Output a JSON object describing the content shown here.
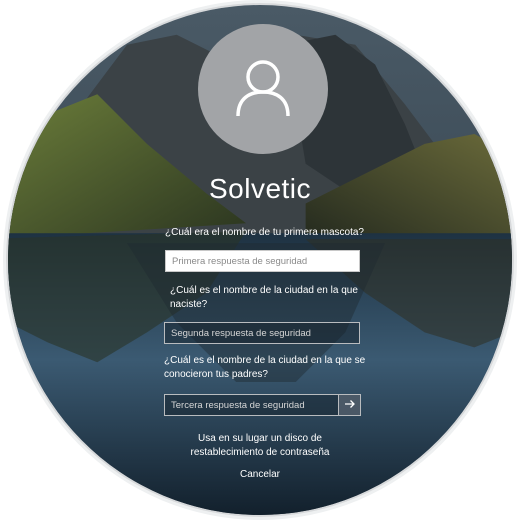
{
  "user": {
    "name": "Solvetic",
    "avatar_icon": "user-icon"
  },
  "questions": [
    {
      "question": "¿Cuál era el nombre de tu primera mascota?",
      "placeholder": "Primera respuesta de seguridad"
    },
    {
      "question": "¿Cuál es el nombre de la ciudad en la que naciste?",
      "placeholder": "Segunda respuesta de seguridad"
    },
    {
      "question": "¿Cuál es el nombre de la ciudad en la que se conocieron tus padres?",
      "placeholder": "Tercera respuesta de seguridad"
    }
  ],
  "submit_icon": "arrow-right-icon",
  "reset_disk_link": "Usa en su lugar un disco de restablecimiento de contraseña",
  "cancel_label": "Cancelar",
  "colors": {
    "text": "#ffffff",
    "avatar_bg": "#a2a4a7",
    "lake": "#1a3346"
  }
}
